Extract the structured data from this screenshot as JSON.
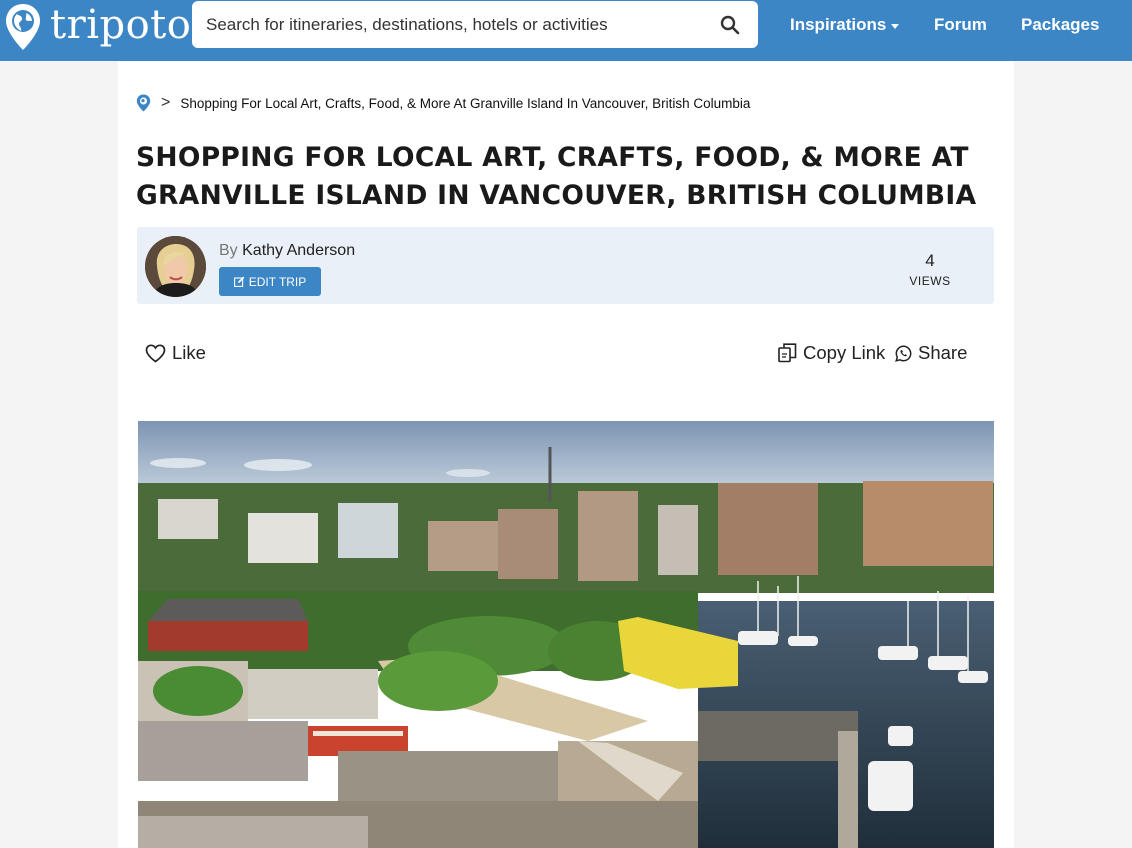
{
  "header": {
    "logo_text": "tripoto",
    "search_placeholder": "Search for itineraries, destinations, hotels or activities",
    "nav": {
      "inspirations": "Inspirations",
      "forum": "Forum",
      "packages": "Packages"
    }
  },
  "breadcrumb": {
    "separator": ">",
    "current": "Shopping For Local Art, Crafts, Food, & More At Granville Island In Vancouver, British Columbia"
  },
  "article": {
    "title_line1": "SHOPPING FOR LOCAL ART, CRAFTS, FOOD, & MORE AT",
    "title_line2": "GRANVILLE ISLAND IN VANCOUVER, BRITISH COLUMBIA"
  },
  "author": {
    "by_label": "By",
    "name": "Kathy Anderson",
    "edit_label": "EDIT TRIP",
    "views_count": "4",
    "views_label": "VIEWS"
  },
  "actions": {
    "like": "Like",
    "copy_link": "Copy Link",
    "share": "Share"
  },
  "colors": {
    "brand_blue": "#3d86c6",
    "author_box_bg": "#e9f0f7"
  },
  "icons": {
    "logo": "map-pin-globe-icon",
    "search": "search-icon",
    "like": "heart-icon",
    "copy": "copy-icon",
    "share": "whatsapp-icon",
    "edit": "edit-icon"
  }
}
